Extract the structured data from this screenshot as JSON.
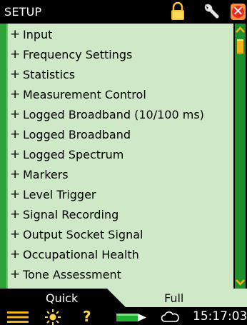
{
  "title_bar": {
    "title": "SETUP",
    "icons": [
      "lock-icon",
      "wrench-icon",
      "close-icon"
    ],
    "colors": {
      "background": "#000000",
      "lock": "#f2c230",
      "close_bg": "#e52b1e"
    }
  },
  "setup_list": {
    "items": [
      {
        "expander": "+",
        "label": "Input"
      },
      {
        "expander": "+",
        "label": "Frequency Settings"
      },
      {
        "expander": "+",
        "label": "Statistics"
      },
      {
        "expander": "+",
        "label": "Measurement Control"
      },
      {
        "expander": "+",
        "label": "Logged Broadband (10/100 ms)"
      },
      {
        "expander": "+",
        "label": "Logged Broadband"
      },
      {
        "expander": "+",
        "label": "Logged Spectrum"
      },
      {
        "expander": "+",
        "label": "Markers"
      },
      {
        "expander": "+",
        "label": "Level Trigger"
      },
      {
        "expander": "+",
        "label": "Signal Recording"
      },
      {
        "expander": "+",
        "label": "Output Socket Signal"
      },
      {
        "expander": "+",
        "label": "Occupational Health"
      },
      {
        "expander": "+",
        "label": "Tone Assessment"
      }
    ],
    "colors": {
      "background": "#cfe8c8",
      "accent_strip": "#2ea236"
    }
  },
  "scrollbar": {
    "icons": [
      "scroll-up-icon",
      "scroll-down-icon"
    ],
    "colors": {
      "track": "#1c8f2a",
      "arrows": "#f2b21a"
    }
  },
  "tabs": {
    "items": [
      {
        "label": "Quick",
        "selected": true
      },
      {
        "label": "Full",
        "selected": false
      }
    ],
    "colors": {
      "selected": "#000000",
      "unselected": "#cfe8c8"
    }
  },
  "status_bar": {
    "icons": [
      "menu-icon",
      "sun-icon",
      "help-icon",
      "battery-icon",
      "cloud-icon"
    ],
    "help_glyph": "?",
    "time": "15:17:03"
  }
}
